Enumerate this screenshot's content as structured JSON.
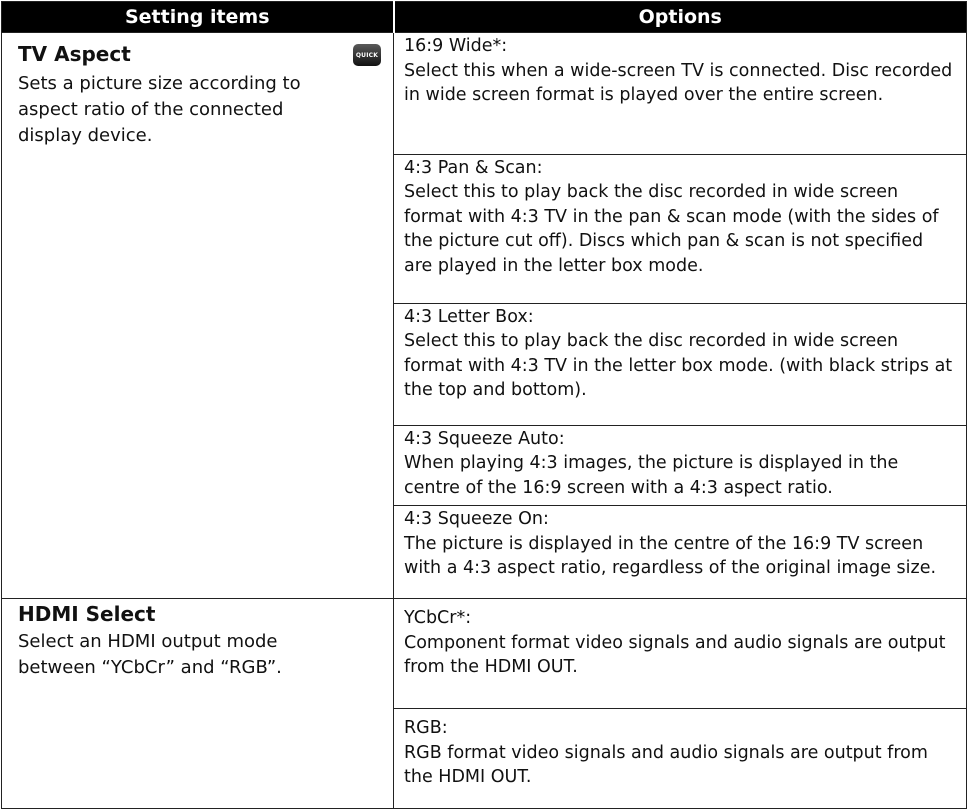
{
  "header": {
    "col1": "Setting items",
    "col2": "Options"
  },
  "quick_badge": "QUICK",
  "tv_aspect": {
    "title": "TV Aspect",
    "description": "Sets a picture size according to aspect ratio of the connected display device.",
    "options": [
      {
        "name": "16:9 Wide*:",
        "desc": "Select this when a wide-screen TV is connected. Disc recorded in wide screen format is played over the entire screen."
      },
      {
        "name": "4:3 Pan & Scan:",
        "desc": "Select this to play back the disc recorded in wide screen format with 4:3 TV in the pan & scan mode (with the sides of the picture cut off). Discs which pan & scan is not specified are played in the letter box mode."
      },
      {
        "name": "4:3 Letter Box:",
        "desc": "Select this to play back the disc recorded in wide screen format with 4:3 TV in the letter box mode. (with black strips at the top and bottom)."
      },
      {
        "name": "4:3 Squeeze Auto:",
        "desc": "When playing 4:3 images, the picture is displayed in the centre of the 16:9 screen with a 4:3 aspect ratio."
      },
      {
        "name": "4:3 Squeeze On:",
        "desc": "The picture is displayed in the centre of the 16:9 TV screen with a 4:3 aspect ratio, regardless of the original image size."
      }
    ]
  },
  "hdmi_select": {
    "title": "HDMI Select",
    "description": "Select an HDMI output mode between “YCbCr” and “RGB”.",
    "options": [
      {
        "name": "YCbCr*:",
        "desc": "Component format video signals and audio signals are output from the HDMI OUT."
      },
      {
        "name": "RGB:",
        "desc": "RGB format video signals and audio signals are output from the HDMI OUT."
      }
    ]
  }
}
